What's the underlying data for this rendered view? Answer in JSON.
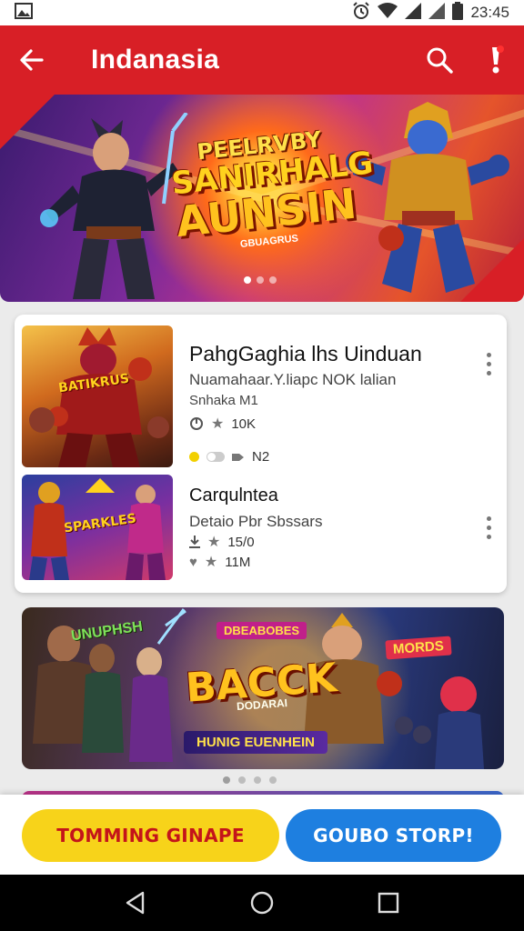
{
  "status_bar": {
    "time": "23:45",
    "icons": [
      "gallery-icon",
      "alarm-icon",
      "wifi-icon",
      "signal-icon",
      "signal-icon",
      "battery-icon"
    ]
  },
  "app_bar": {
    "title": "Indanasia",
    "icons": [
      "back-arrow-icon",
      "search-icon",
      "alert-icon"
    ],
    "color": "#d81f26"
  },
  "hero_banner": {
    "line1": "PEELRVBY",
    "line2": "SANIRHALG",
    "line3": "AUNSIN",
    "line4": "GBUAGRUS",
    "page_count": 3,
    "active_page": 1
  },
  "list": {
    "items": [
      {
        "title": "PahgGaghia lhs Uinduan",
        "subtitle": "Nuamahaar.Y.liapc NOK lalian",
        "subtitle2": "Snhaka M1",
        "meta1": "10K",
        "meta2": "N2",
        "thumb_label": "BATIKRUS"
      },
      {
        "title": "Carqulntea",
        "subtitle": "Detaio  Pbr Sbssars",
        "meta1": "15/0",
        "meta2": "11M",
        "thumb_label": "SPARKLES"
      }
    ]
  },
  "promo_banner": {
    "headline": "BACCK",
    "sub": "DODARAI",
    "strip": "HUNIG EUENHEIN",
    "tag_left": "UNUPHSH",
    "tag_mid": "DBEABOBES",
    "tag_right": "MORDS",
    "page_count": 4,
    "active_page": 0
  },
  "actions": {
    "primary_label": "TOMMING GINAPE",
    "secondary_label": "GOUBO STORP!",
    "primary_color": "#f7d31a",
    "secondary_color": "#1e7fe0"
  },
  "nav_bar": {
    "icons": [
      "back-triangle-icon",
      "home-circle-icon",
      "recents-square-icon"
    ]
  }
}
